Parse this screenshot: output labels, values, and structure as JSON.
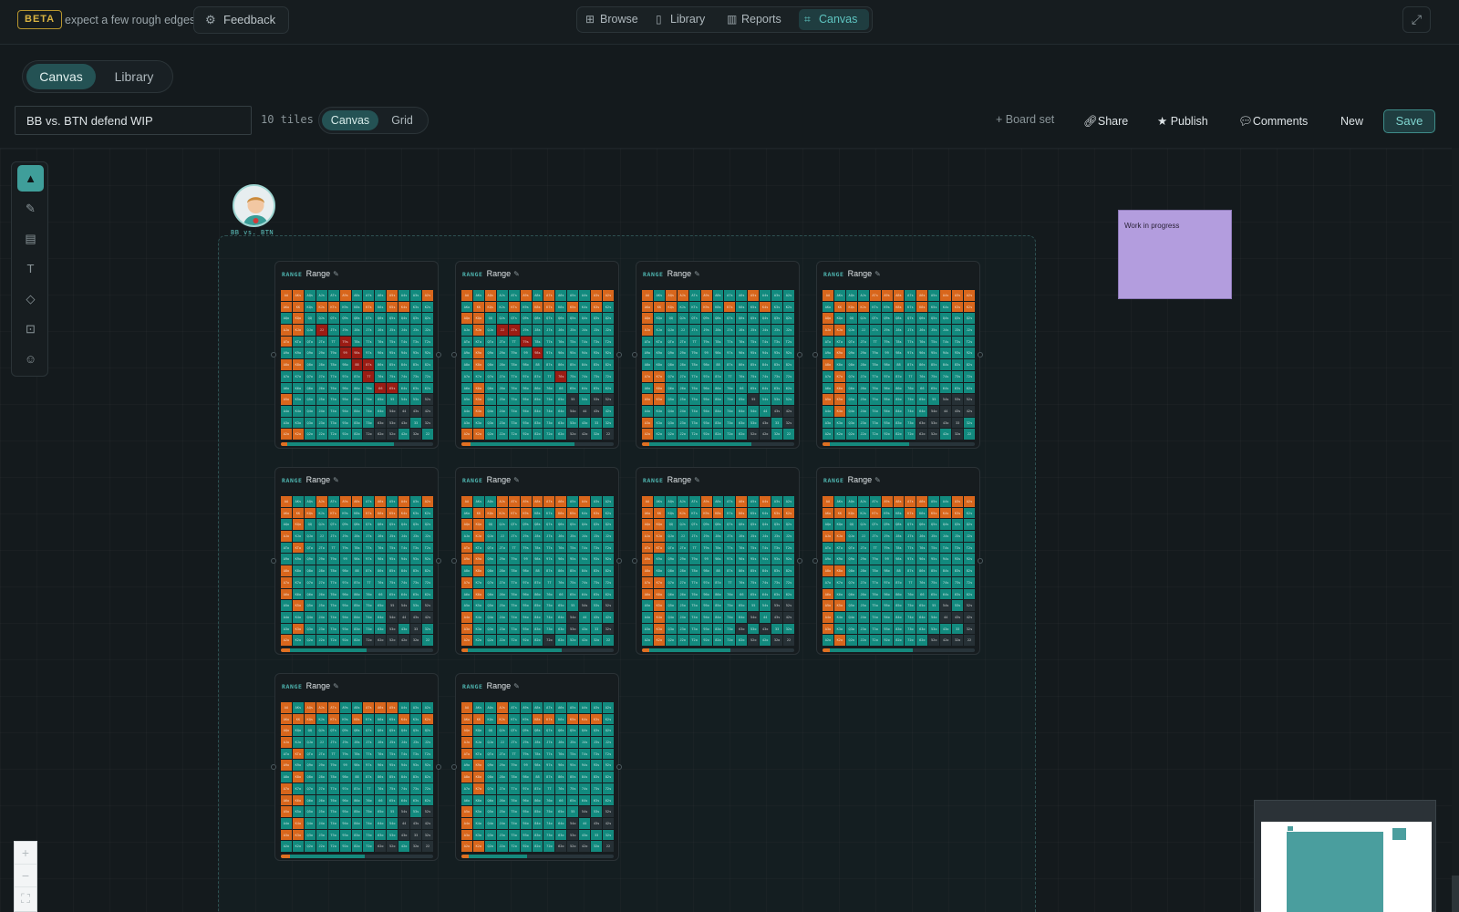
{
  "header": {
    "beta_badge": "BETA",
    "beta_note": "expect a few rough edges",
    "feedback_label": "Feedback",
    "nav": [
      {
        "label": "Browse",
        "icon": "grid-icon",
        "active": false
      },
      {
        "label": "Library",
        "icon": "bookmark-icon",
        "active": false
      },
      {
        "label": "Reports",
        "icon": "bar-chart-icon",
        "active": false
      },
      {
        "label": "Canvas",
        "icon": "canvas-icon",
        "active": true
      }
    ],
    "fullscreen_icon": "expand-icon"
  },
  "mode_switch": {
    "canvas": "Canvas",
    "library": "Library",
    "active": "Canvas"
  },
  "toolbar": {
    "title_value": "BB vs. BTN defend WIP",
    "tile_count": "10 tiles",
    "view_canvas": "Canvas",
    "view_grid": "Grid",
    "active_view": "Canvas",
    "board_set": "+ Board set",
    "share": "Share",
    "publish": "Publish",
    "comments": "Comments",
    "new": "New",
    "save": "Save"
  },
  "tools": [
    "select-icon",
    "pen-icon",
    "table-icon",
    "text-icon",
    "diamond-icon",
    "frame-icon",
    "emoji-icon"
  ],
  "board": {
    "avatar_label": "BB vs. BTN"
  },
  "sticky_note": {
    "text": "Work in progress",
    "color": "#b39dde"
  },
  "colors": {
    "teal": "#128a7e",
    "orange": "#d8661c",
    "red": "#9b1c14",
    "accent": "#5ec4c0"
  },
  "hands": [
    "AA",
    "AKs",
    "AQs",
    "AJs",
    "ATs",
    "A9s",
    "A8s",
    "A7s",
    "A6s",
    "A5s",
    "A4s",
    "A3s",
    "A2s",
    "AKo",
    "KK",
    "KQs",
    "KJs",
    "KTs",
    "K9s",
    "K8s",
    "K7s",
    "K6s",
    "K5s",
    "K4s",
    "K3s",
    "K2s",
    "AQo",
    "KQo",
    "QQ",
    "QJs",
    "QTs",
    "Q9s",
    "Q8s",
    "Q7s",
    "Q6s",
    "Q5s",
    "Q4s",
    "Q3s",
    "Q2s",
    "AJo",
    "KJo",
    "QJo",
    "JJ",
    "JTs",
    "J9s",
    "J8s",
    "J7s",
    "J6s",
    "J5s",
    "J4s",
    "J3s",
    "J2s",
    "ATo",
    "KTo",
    "QTo",
    "JTo",
    "TT",
    "T9s",
    "T8s",
    "T7s",
    "T6s",
    "T5s",
    "T4s",
    "T3s",
    "T2s",
    "A9o",
    "K9o",
    "Q9o",
    "J9o",
    "T9o",
    "99",
    "98s",
    "97s",
    "96s",
    "95s",
    "94s",
    "93s",
    "92s",
    "A8o",
    "K8o",
    "Q8o",
    "J8o",
    "T8o",
    "98o",
    "88",
    "87s",
    "86s",
    "85s",
    "84s",
    "83s",
    "82s",
    "A7o",
    "K7o",
    "Q7o",
    "J7o",
    "T7o",
    "97o",
    "87o",
    "77",
    "76s",
    "75s",
    "74s",
    "73s",
    "72s",
    "A6o",
    "K6o",
    "Q6o",
    "J6o",
    "T6o",
    "96o",
    "86o",
    "76o",
    "66",
    "65s",
    "64s",
    "63s",
    "62s",
    "A5o",
    "K5o",
    "Q5o",
    "J5o",
    "T5o",
    "95o",
    "85o",
    "75o",
    "65o",
    "55",
    "54s",
    "53s",
    "52s",
    "A4o",
    "K4o",
    "Q4o",
    "J4o",
    "T4o",
    "94o",
    "84o",
    "74o",
    "64o",
    "54o",
    "44",
    "43s",
    "42s",
    "A3o",
    "K3o",
    "Q3o",
    "J3o",
    "T3o",
    "93o",
    "83o",
    "73o",
    "63o",
    "53o",
    "43o",
    "33",
    "32s",
    "A2o",
    "K2o",
    "Q2o",
    "J2o",
    "T2o",
    "92o",
    "82o",
    "72o",
    "62o",
    "52o",
    "42o",
    "32o",
    "22"
  ],
  "tiles": [
    {
      "kind": "RANGE",
      "name": "Range",
      "raise": 0.04,
      "call": 0.7,
      "seed": 3
    },
    {
      "kind": "RANGE",
      "name": "Range",
      "raise": 0.06,
      "call": 0.68,
      "seed": 7
    },
    {
      "kind": "RANGE",
      "name": "Range",
      "raise": 0.05,
      "call": 0.67,
      "seed": 11
    },
    {
      "kind": "RANGE",
      "name": "Range",
      "raise": 0.05,
      "call": 0.52,
      "seed": 13
    },
    {
      "kind": "RANGE",
      "name": "Range",
      "raise": 0.06,
      "call": 0.5,
      "seed": 17
    },
    {
      "kind": "RANGE",
      "name": "Range",
      "raise": 0.04,
      "call": 0.62,
      "seed": 19
    },
    {
      "kind": "RANGE",
      "name": "Range",
      "raise": 0.05,
      "call": 0.53,
      "seed": 23
    },
    {
      "kind": "RANGE",
      "name": "Range",
      "raise": 0.05,
      "call": 0.54,
      "seed": 29
    },
    {
      "kind": "RANGE",
      "name": "Range",
      "raise": 0.06,
      "call": 0.49,
      "seed": 31
    },
    {
      "kind": "RANGE",
      "name": "Range",
      "raise": 0.05,
      "call": 0.38,
      "seed": 37
    }
  ],
  "zoom": {
    "in": "+",
    "out": "−"
  }
}
